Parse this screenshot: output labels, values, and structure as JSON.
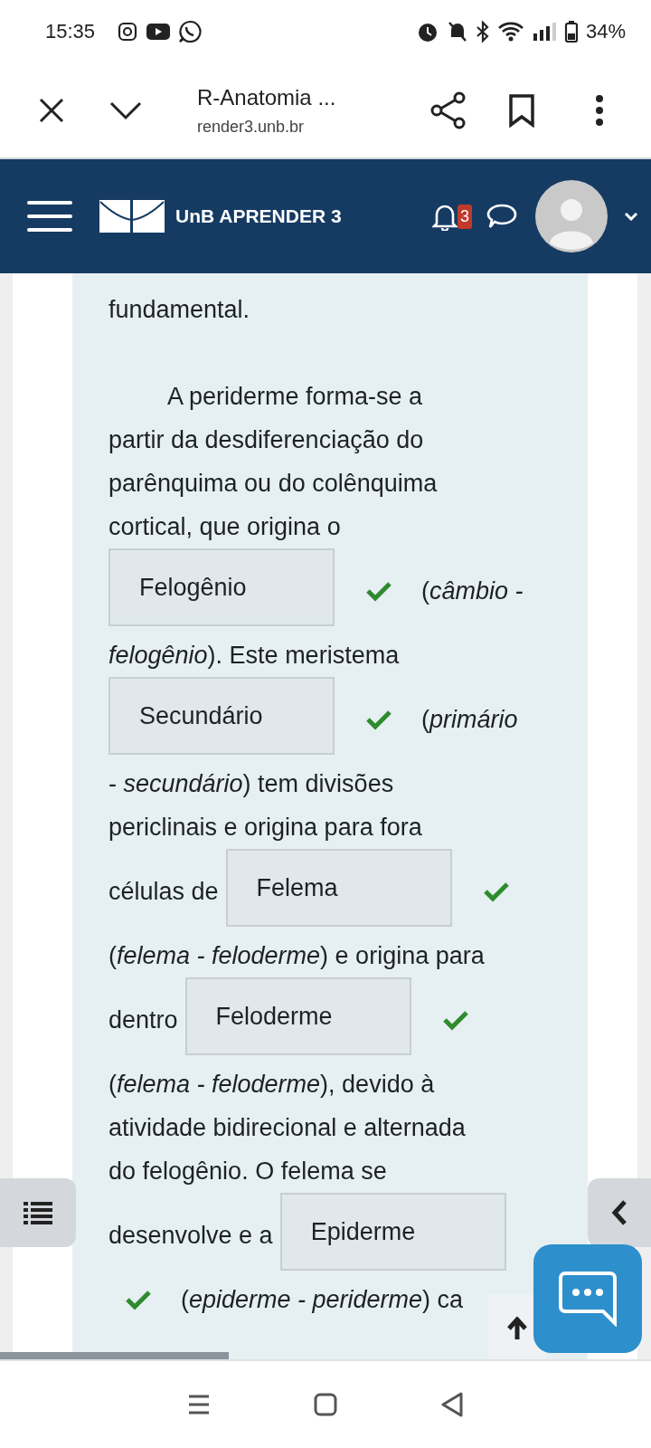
{
  "status_bar": {
    "time": "15:35",
    "battery": "34%"
  },
  "browser": {
    "title": "R-Anatomia ...",
    "url": "render3.unb.br"
  },
  "site": {
    "name": "UnB APRENDER 3",
    "notifications": "3"
  },
  "content": {
    "paragraphs": [
      {
        "lines": [
          [
            {
              "kind": "text",
              "text": "fundamental."
            }
          ]
        ]
      },
      {
        "lines": [
          [
            {
              "kind": "text",
              "text": "A periderme forma-se a"
            }
          ],
          [
            {
              "kind": "text",
              "text": "partir da desdiferenciação do"
            }
          ],
          [
            {
              "kind": "text",
              "text": "parênquima ou do colênquima"
            }
          ],
          [
            {
              "kind": "text",
              "text": "cortical, que origina o"
            }
          ],
          [
            {
              "kind": "answer",
              "value": "Felogênio"
            },
            {
              "kind": "result",
              "correct": true
            },
            {
              "kind": "text",
              "text": "(*câmbio -*"
            }
          ],
          [
            {
              "kind": "text",
              "text": "*felogênio*). Este meristema"
            }
          ],
          [
            {
              "kind": "answer",
              "value": "Secundário"
            },
            {
              "kind": "result",
              "correct": true
            },
            {
              "kind": "text",
              "text": "(*primário*"
            }
          ],
          [
            {
              "kind": "text",
              "text": "- *secundário*) tem divisões"
            }
          ],
          [
            {
              "kind": "text",
              "text": "periclinais e origina para fora"
            }
          ],
          [
            {
              "kind": "text",
              "text": "células de"
            },
            {
              "kind": "answer",
              "value": "Felema"
            },
            {
              "kind": "result",
              "correct": true
            }
          ],
          [
            {
              "kind": "text",
              "text": "(*felema - feloderme*) e origina para"
            }
          ],
          [
            {
              "kind": "text",
              "text": "dentro"
            },
            {
              "kind": "answer",
              "value": "Feloderme"
            },
            {
              "kind": "result",
              "correct": true
            }
          ],
          [
            {
              "kind": "text",
              "text": "(*felema - feloderme*), devido à"
            }
          ],
          [
            {
              "kind": "text",
              "text": "atividade bidirecional e alternada"
            }
          ],
          [
            {
              "kind": "text",
              "text": "do felogênio. O felema se"
            }
          ],
          [
            {
              "kind": "text",
              "text": "desenvolve e a"
            },
            {
              "kind": "answer",
              "value": "Epiderme"
            }
          ],
          [
            {
              "kind": "result",
              "correct": true
            },
            {
              "kind": "text",
              "text": "(*epiderme - periderme*) ca"
            }
          ]
        ]
      }
    ]
  }
}
